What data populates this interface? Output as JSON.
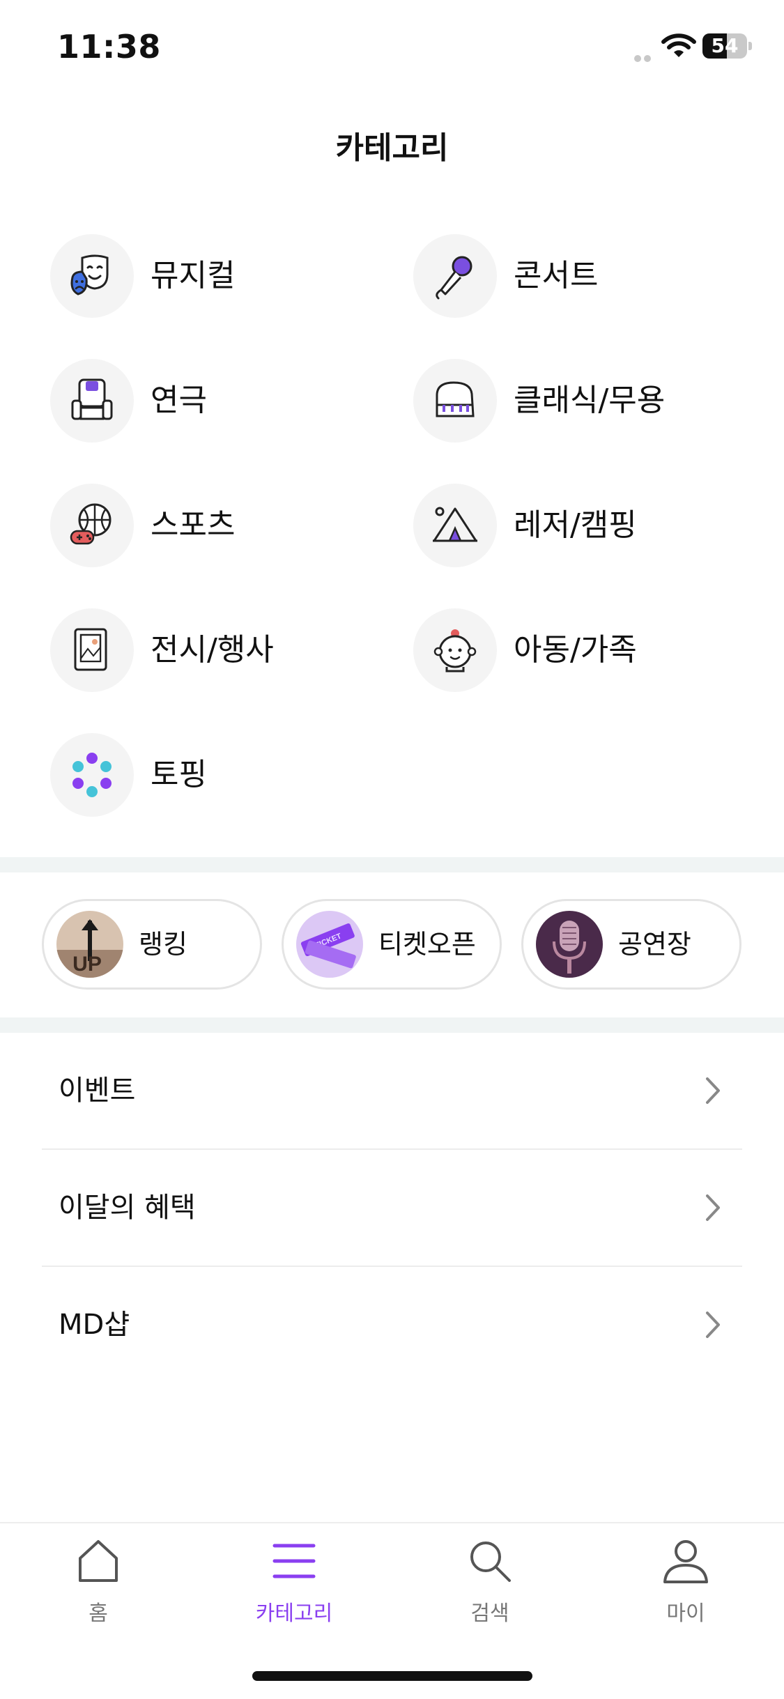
{
  "status_bar": {
    "time": "11:38",
    "battery_percent": 54,
    "battery_label": "54"
  },
  "page": {
    "title": "카테고리"
  },
  "categories": [
    {
      "label": "뮤지컬",
      "icon": "theater-mask-icon"
    },
    {
      "label": "콘서트",
      "icon": "microphone-icon"
    },
    {
      "label": "연극",
      "icon": "theater-seat-icon"
    },
    {
      "label": "클래식/무용",
      "icon": "piano-icon"
    },
    {
      "label": "스포츠",
      "icon": "basketball-gamepad-icon"
    },
    {
      "label": "레저/캠핑",
      "icon": "camping-tent-icon"
    },
    {
      "label": "전시/행사",
      "icon": "picture-frame-icon"
    },
    {
      "label": "아동/가족",
      "icon": "baby-face-icon"
    },
    {
      "label": "토핑",
      "icon": "toping-flower-icon"
    }
  ],
  "quick_links": [
    {
      "label": "랭킹",
      "thumb_text": "UP"
    },
    {
      "label": "티켓오픈",
      "thumb_text": "TICKET"
    },
    {
      "label": "공연장"
    }
  ],
  "menu": [
    {
      "label": "이벤트"
    },
    {
      "label": "이달의 혜택"
    },
    {
      "label": "MD샵"
    }
  ],
  "tab_bar": {
    "active": "카테고리",
    "tabs": [
      {
        "label": "홈",
        "icon": "home-icon"
      },
      {
        "label": "카테고리",
        "icon": "menu-icon"
      },
      {
        "label": "검색",
        "icon": "search-icon"
      },
      {
        "label": "마이",
        "icon": "person-icon"
      }
    ]
  },
  "colors": {
    "accent": "#8a3ff0",
    "icon_bg": "#f4f4f4",
    "divider_band": "#f0f4f4"
  }
}
